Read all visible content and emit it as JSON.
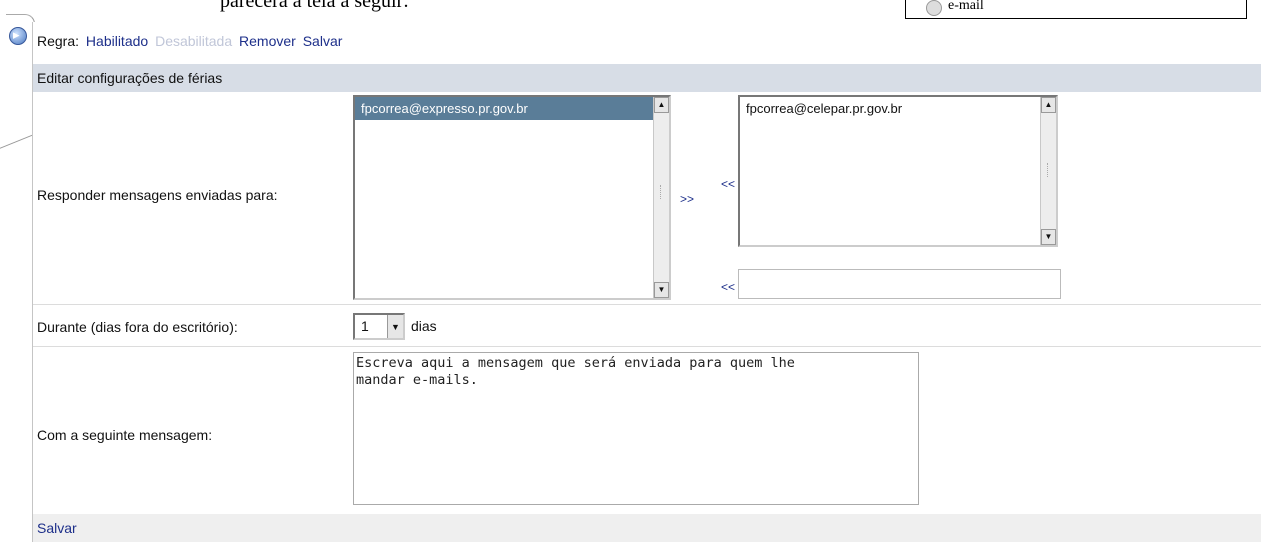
{
  "document": {
    "cut_text": "parecerá a tela a seguir:",
    "cut_box_text": "e-mail"
  },
  "rule_bar": {
    "prefix": "Regra:",
    "enabled": "Habilitado",
    "disabled": "Desabilitada",
    "remove": "Remover",
    "save": "Salvar"
  },
  "section_title": "Editar configurações de férias",
  "reply": {
    "label": "Responder mensagens enviadas para:",
    "available": [
      "fpcorrea@expresso.pr.gov.br"
    ],
    "selected": [
      "fpcorrea@celepar.pr.gov.br"
    ],
    "add_button": ">>",
    "remove_button": "<<",
    "add_from_field_button": "<<",
    "new_address_value": ""
  },
  "duration": {
    "label": "Durante (dias fora do escritório):",
    "value": "1",
    "unit": "dias"
  },
  "message": {
    "label": "Com a seguinte mensagem:",
    "text": "Escreva aqui a mensagem que será enviada para quem lhe\nmandar e-mails."
  },
  "footer": {
    "save": "Salvar"
  },
  "colors": {
    "link": "#1d2f8a",
    "disabled": "#c0c6d8",
    "section_header_bg": "#d7dde6",
    "selected_item_bg": "#5a7d98"
  }
}
